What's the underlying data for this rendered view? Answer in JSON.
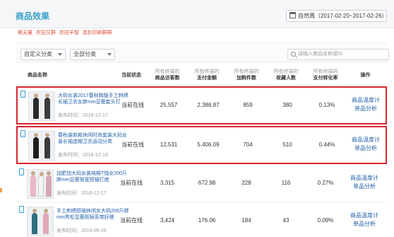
{
  "header": {
    "title": "商品效果",
    "date_range": "自然周（2017-02-20~2017-02-26）"
  },
  "tabs": [
    "稀无量",
    "农田又群",
    "农田羊智",
    "连扒印刷群群"
  ],
  "filters": {
    "custom_category": "自定义分类",
    "all_category": "全部分类",
    "search_placeholder": "请输入商品名称或ID"
  },
  "columns": {
    "name": "商品名称",
    "status": "当前状态",
    "visits_sub": "所有终端的",
    "visits": "商品访客数",
    "amount_sub": "所有终端的",
    "amount": "支付金额",
    "carts_sub": "所有终端的",
    "carts": "加购件数",
    "favs_sub": "所有终端的",
    "favs": "收藏人数",
    "conv_sub": "所有终端的",
    "conv": "支付转化率",
    "ops": "操作"
  },
  "rows": [
    {
      "name": "大码女装2017春秋韩版手工刺绣长袖卫衣女胖mm显瘦套头打",
      "date": "发布时间：2016-12-17",
      "status": "当前在线",
      "visits": "25,557",
      "amount": "2,386.87",
      "carts": "859",
      "favs": "380",
      "conv": "0.13%",
      "op1": "商品温度计",
      "op2": "单品分析"
    },
    {
      "name": "春秋装新款休闲时尚套装大码女装长袖连帽卫衣运动分类",
      "date": "发布时间：2016-12-19",
      "status": "当前在线",
      "visits": "12,531",
      "amount": "5,406.09",
      "carts": "704",
      "favs": "510",
      "conv": "0.44%",
      "op1": "商品温度计",
      "op2": "单品分析"
    },
    {
      "name": "加肥加大码女装纯棉T恤女200斤胖mm显瘦很宽短袖打底",
      "date": "发布时间：2016-12-17",
      "status": "当前在线",
      "visits": "3,315",
      "amount": "672.98",
      "carts": "228",
      "favs": "116",
      "conv": "0.27%",
      "op1": "商品温度计",
      "op2": "单品分析"
    },
    {
      "name": "手工刺绣短袖休闲女大码200斤胖mm秀松显瘦斑掉系带好搭",
      "date": "发布时间：2016-05-26",
      "status": "当前在线",
      "visits": "3,424",
      "amount": "176.06",
      "carts": "184",
      "favs": "43",
      "conv": "0.09%",
      "op1": "商品温度计",
      "op2": "单品分析"
    }
  ],
  "icons": {
    "date": "calendar-icon",
    "search": "search-icon",
    "device": "mobile-icon"
  },
  "colors": {
    "accent": "#3aa0c8",
    "link": "#1f5fa8",
    "highlight_border": "#d9262e"
  }
}
